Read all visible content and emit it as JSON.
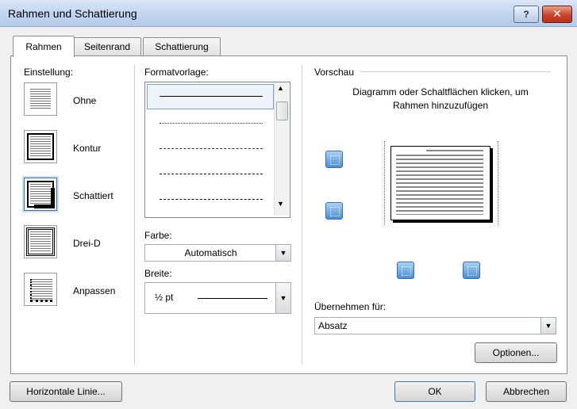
{
  "window": {
    "title": "Rahmen und Schattierung",
    "help_label": "?",
    "close_label": "✕"
  },
  "tabs": [
    {
      "label": "Rahmen"
    },
    {
      "label": "Seitenrand"
    },
    {
      "label": "Schattierung"
    }
  ],
  "einstellung": {
    "label": "Einstellung:",
    "items": [
      {
        "label": "Ohne"
      },
      {
        "label": "Kontur"
      },
      {
        "label": "Schattiert"
      },
      {
        "label": "Drei-D"
      },
      {
        "label": "Anpassen"
      }
    ],
    "selected": "Schattiert"
  },
  "formatvorlage": {
    "label": "Formatvorlage:"
  },
  "farbe": {
    "label": "Farbe:",
    "value": "Automatisch"
  },
  "breite": {
    "label": "Breite:",
    "value": "½ pt"
  },
  "vorschau": {
    "label": "Vorschau",
    "hint": "Diagramm oder Schaltflächen klicken, um Rahmen hinzuzufügen"
  },
  "uebernehmen": {
    "label": "Übernehmen für:",
    "value": "Absatz"
  },
  "buttons": {
    "optionen": "Optionen...",
    "horizontale_linie": "Horizontale Linie...",
    "ok": "OK",
    "abbrechen": "Abbrechen"
  },
  "icons": {
    "dropdown": "▼",
    "scroll_up": "▲",
    "scroll_down": "▼"
  }
}
